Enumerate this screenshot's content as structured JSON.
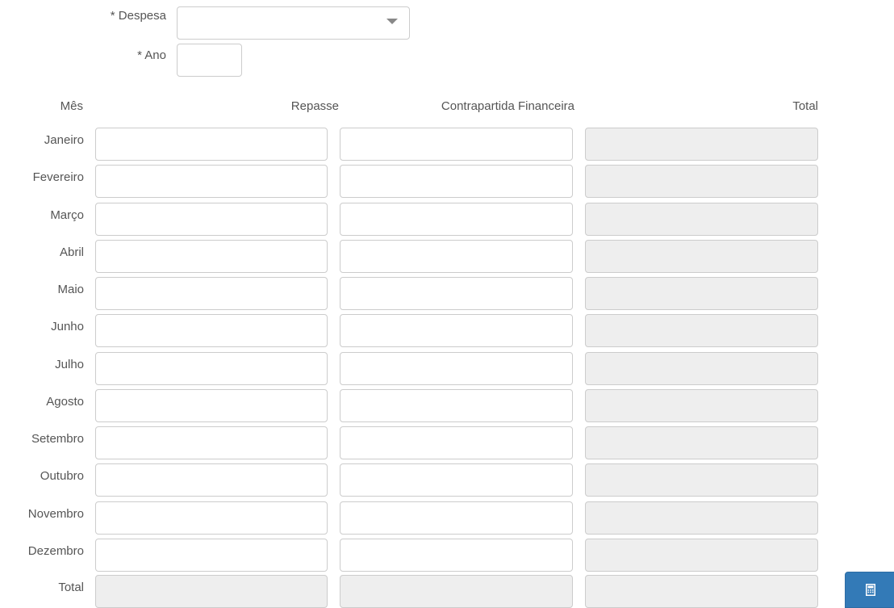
{
  "form": {
    "despesa_label": "* Despesa",
    "despesa_value": "",
    "ano_label": "* Ano",
    "ano_value": ""
  },
  "table": {
    "headers": {
      "mes": "Mês",
      "repasse": "Repasse",
      "contrapartida": "Contrapartida Financeira",
      "total": "Total"
    },
    "rows": [
      {
        "month": "Janeiro",
        "repasse": "",
        "contrapartida": "",
        "total": ""
      },
      {
        "month": "Fevereiro",
        "repasse": "",
        "contrapartida": "",
        "total": ""
      },
      {
        "month": "Março",
        "repasse": "",
        "contrapartida": "",
        "total": ""
      },
      {
        "month": "Abril",
        "repasse": "",
        "contrapartida": "",
        "total": ""
      },
      {
        "month": "Maio",
        "repasse": "",
        "contrapartida": "",
        "total": ""
      },
      {
        "month": "Junho",
        "repasse": "",
        "contrapartida": "",
        "total": ""
      },
      {
        "month": "Julho",
        "repasse": "",
        "contrapartida": "",
        "total": ""
      },
      {
        "month": "Agosto",
        "repasse": "",
        "contrapartida": "",
        "total": ""
      },
      {
        "month": "Setembro",
        "repasse": "",
        "contrapartida": "",
        "total": ""
      },
      {
        "month": "Outubro",
        "repasse": "",
        "contrapartida": "",
        "total": ""
      },
      {
        "month": "Novembro",
        "repasse": "",
        "contrapartida": "",
        "total": ""
      },
      {
        "month": "Dezembro",
        "repasse": "",
        "contrapartida": "",
        "total": ""
      }
    ],
    "total_row": {
      "label": "Total",
      "repasse": "",
      "contrapartida": "",
      "total": ""
    }
  },
  "calculator_button": {
    "icon": "calculator-icon",
    "color": "#337ab7"
  },
  "colors": {
    "label_text": "#555555",
    "input_border": "#cccccc",
    "readonly_bg": "#eeeeee"
  }
}
